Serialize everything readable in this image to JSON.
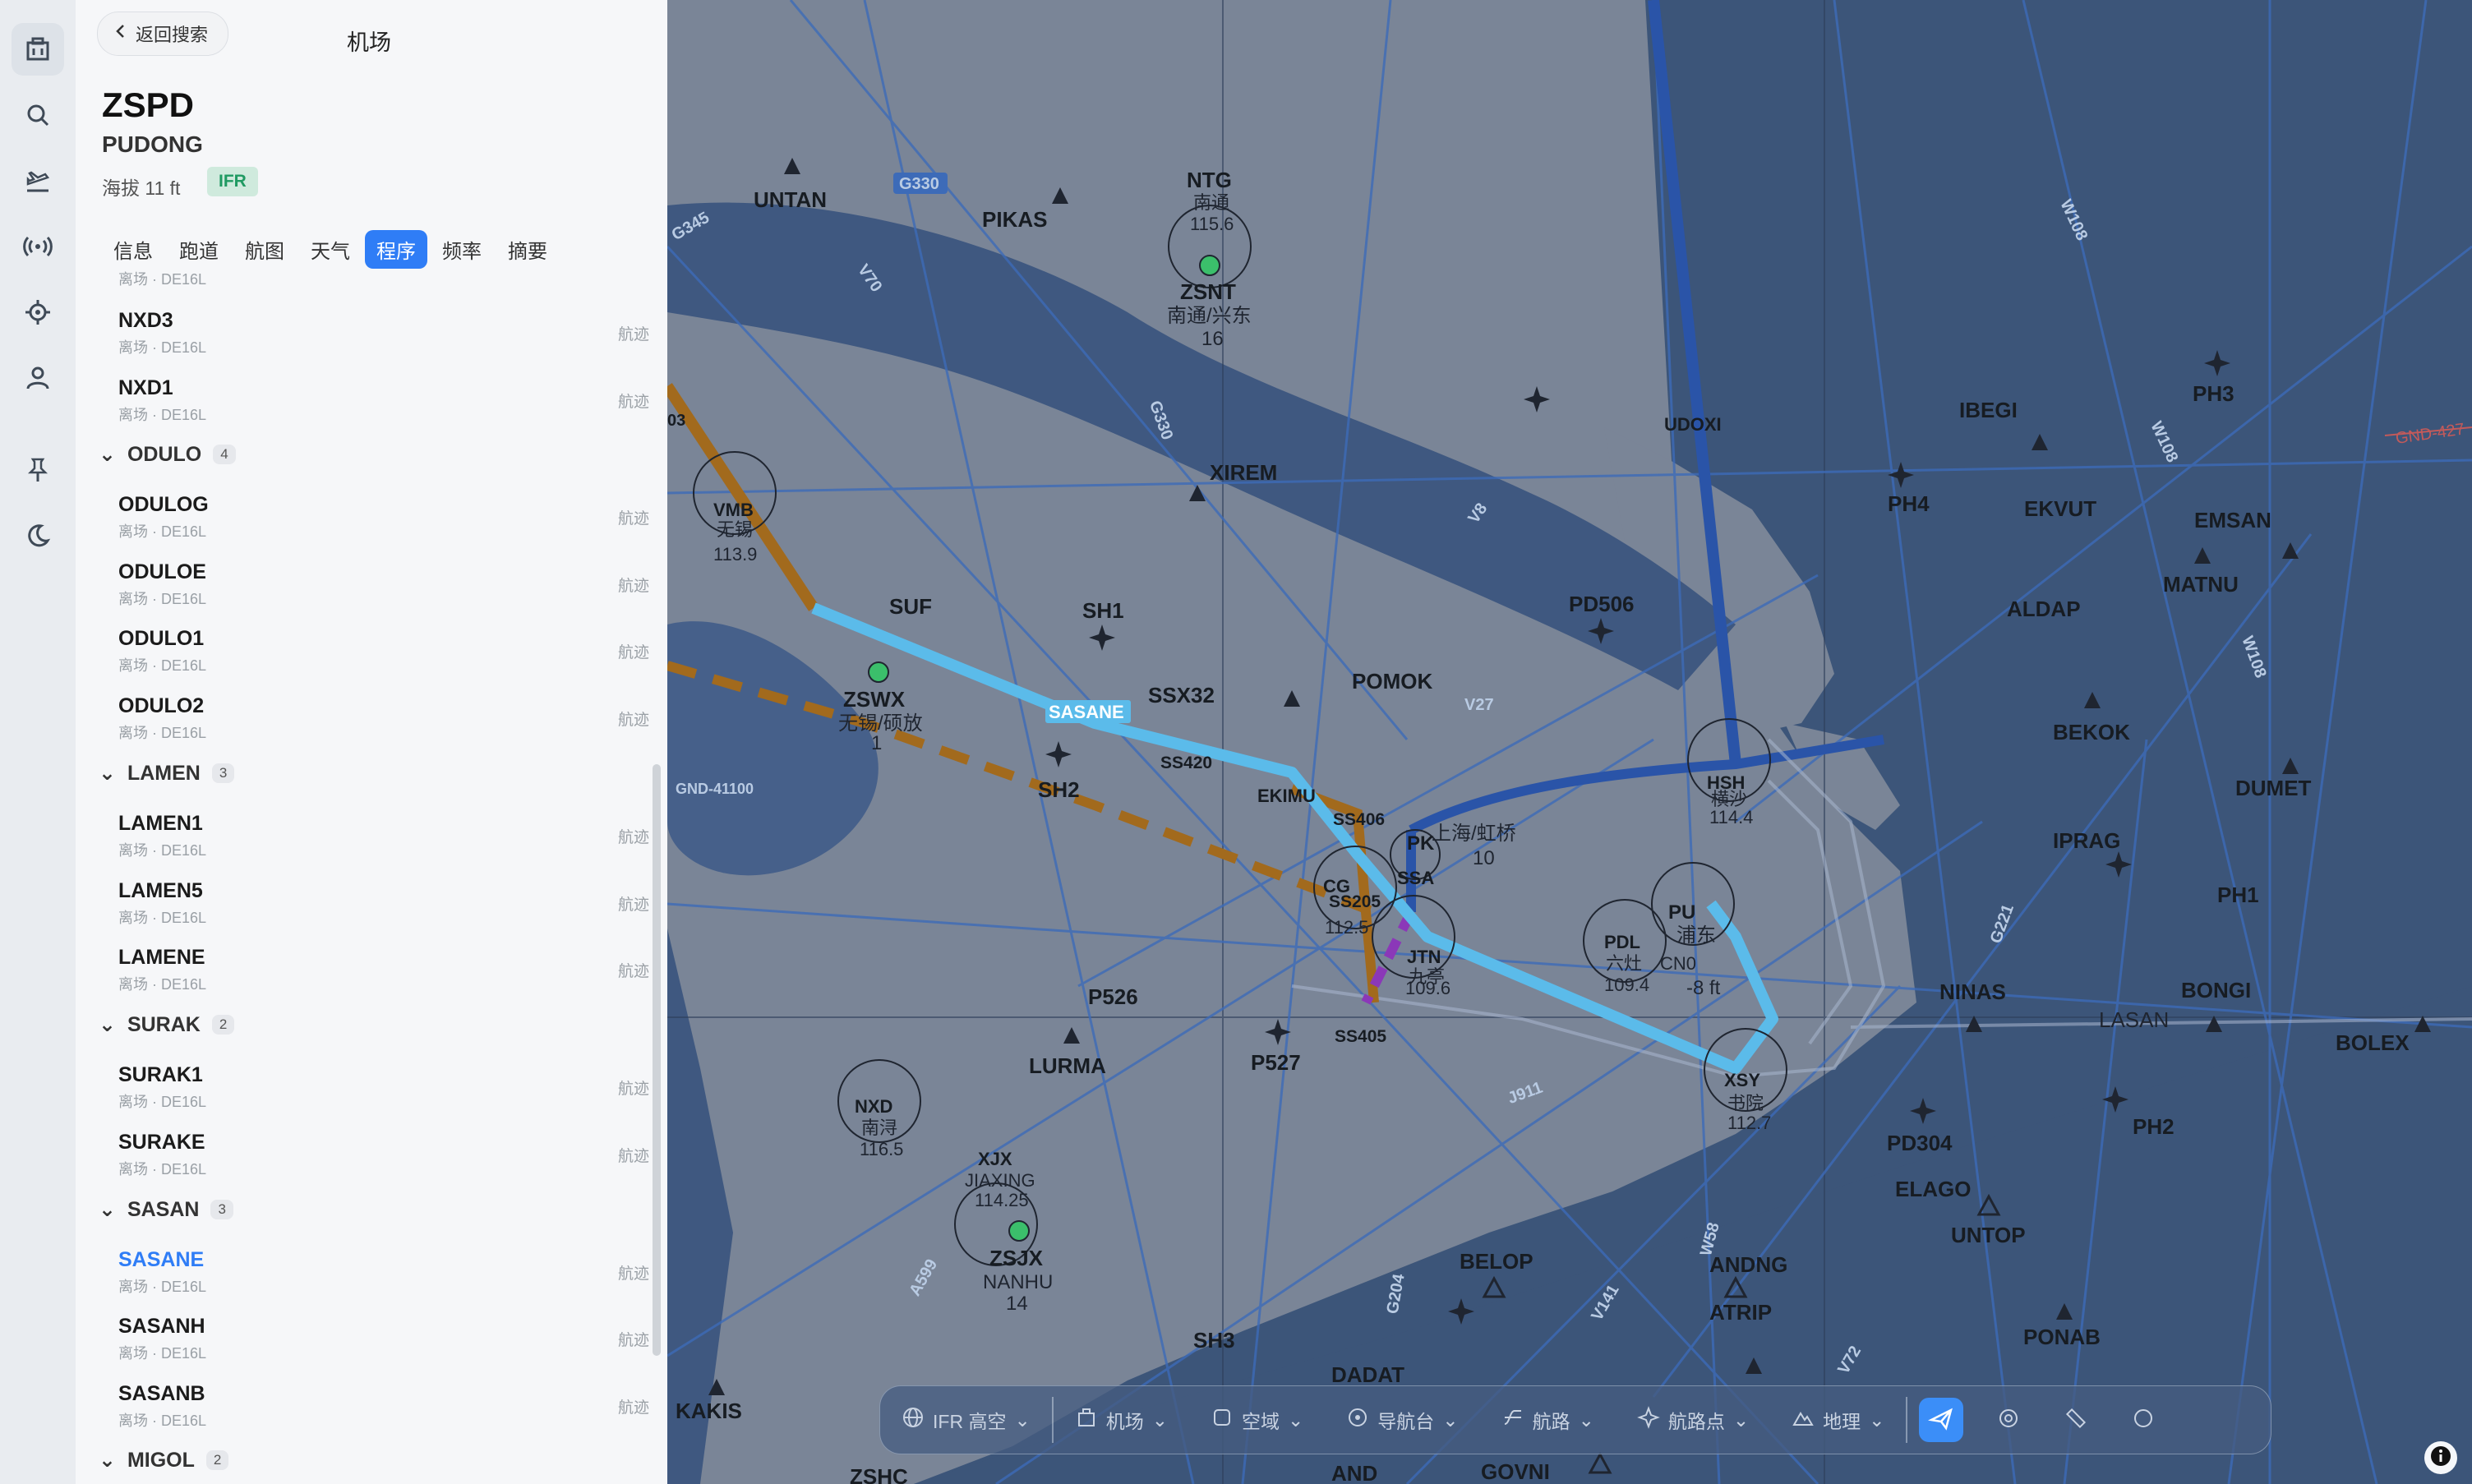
{
  "rail": {
    "items": [
      {
        "name": "airport-icon"
      },
      {
        "name": "search-icon"
      },
      {
        "name": "departure-icon"
      },
      {
        "name": "radio-icon"
      },
      {
        "name": "target-icon"
      },
      {
        "name": "user-icon"
      },
      {
        "name": "pin-icon"
      },
      {
        "name": "moon-icon"
      }
    ]
  },
  "panel": {
    "back_label": "返回搜索",
    "title": "机场",
    "icao": "ZSPD",
    "name": "PUDONG",
    "elevation": "海拔 11 ft",
    "flight_rule": "IFR",
    "tabs": [
      "信息",
      "跑道",
      "航图",
      "天气",
      "程序",
      "频率",
      "摘要"
    ],
    "active_tab": "程序",
    "top_sub": "离场 · DE16L",
    "track_label": "航迹",
    "rows": [
      {
        "name": "NXD3",
        "sub": "离场 · DE16L"
      },
      {
        "name": "NXD1",
        "sub": "离场 · DE16L"
      },
      {
        "name": "ODULOG",
        "sub": "离场 · DE16L"
      },
      {
        "name": "ODULOE",
        "sub": "离场 · DE16L"
      },
      {
        "name": "ODULO1",
        "sub": "离场 · DE16L"
      },
      {
        "name": "ODULO2",
        "sub": "离场 · DE16L"
      },
      {
        "name": "LAMEN1",
        "sub": "离场 · DE16L"
      },
      {
        "name": "LAMEN5",
        "sub": "离场 · DE16L"
      },
      {
        "name": "LAMENE",
        "sub": "离场 · DE16L"
      },
      {
        "name": "SURAK1",
        "sub": "离场 · DE16L"
      },
      {
        "name": "SURAKE",
        "sub": "离场 · DE16L"
      },
      {
        "name": "SASANE",
        "sub": "离场 · DE16L"
      },
      {
        "name": "SASANH",
        "sub": "离场 · DE16L"
      },
      {
        "name": "SASANB",
        "sub": "离场 · DE16L"
      }
    ],
    "groups": [
      {
        "name": "ODULO",
        "count": "4"
      },
      {
        "name": "LAMEN",
        "count": "3"
      },
      {
        "name": "SURAK",
        "count": "2"
      },
      {
        "name": "SASAN",
        "count": "3"
      },
      {
        "name": "MIGOL",
        "count": "2"
      }
    ]
  },
  "map": {
    "fixes": [
      "UNTAN",
      "PIKAS",
      "XIREM",
      "SUF",
      "SH1",
      "SSX32",
      "POMOK",
      "SH2",
      "EKIMU",
      "SS406",
      "SS420",
      "SS205",
      "SS405",
      "UDOXI",
      "PD506",
      "IBEGI",
      "PH3",
      "PH4",
      "EKVUT",
      "EMSAN",
      "ALDAP",
      "MATNU",
      "BEKOK",
      "DUMET",
      "IPRAG",
      "PH1",
      "NINAS",
      "LASAN",
      "BONGI",
      "BOLEX",
      "PD304",
      "ELAGO",
      "UNTOP",
      "PH2",
      "PONAB",
      "ANDNG",
      "ATRIP",
      "BELOP",
      "DADAT",
      "SH3",
      "P526",
      "P527",
      "LURMA",
      "KAKIS",
      "GOVNI",
      "AND",
      "ZSHC"
    ],
    "airways": [
      "G330",
      "V70",
      "G345",
      "G330",
      "V8",
      "V27",
      "W108",
      "W108",
      "W108",
      "G221",
      "J911",
      "W58",
      "G204",
      "V141",
      "V72",
      "A599"
    ],
    "navaids": [
      {
        "id": "NTG",
        "name": "南通",
        "freq": "115.6"
      },
      {
        "id": "VMB",
        "name": "无锡",
        "freq": "113.9"
      },
      {
        "id": "HSH",
        "name": "横沙",
        "freq": "114.4"
      },
      {
        "id": "PDL",
        "name": "六灶",
        "freq": "109.4"
      },
      {
        "id": "XSY",
        "name": "书院",
        "freq": "112.7"
      },
      {
        "id": "NXD",
        "name": "南浔",
        "freq": "116.5"
      },
      {
        "id": "XJX",
        "name": "JIAXING",
        "freq": "114.25"
      },
      {
        "id": "JTN",
        "name": "九亭",
        "freq": "109.6"
      },
      {
        "id": "CG",
        "name": "",
        "freq": "112.5"
      }
    ],
    "airports": [
      {
        "code": "ZSNT",
        "name": "南通/兴东",
        "elev": "16"
      },
      {
        "code": "ZSWX",
        "name": "无锡/硕放",
        "elev": "1"
      },
      {
        "code": "ZSJX",
        "name": "NANHU",
        "elev": "14"
      },
      {
        "code": "PK",
        "name": "上海/虹桥",
        "elev": "10"
      },
      {
        "code": "PU",
        "name": "浦东",
        "elev": "-8 ft"
      }
    ],
    "gnd_labels": [
      "GND-41100",
      "GND-427"
    ],
    "procedure_label": "SASANE",
    "extra_labels": [
      "03",
      "CN0",
      "SSA"
    ]
  },
  "toolbar": {
    "items": [
      "IFR 高空",
      "机场",
      "空域",
      "导航台",
      "航路",
      "航路点",
      "地理"
    ]
  },
  "colors": {
    "accent": "#2f7df6",
    "route": "#5bbbea",
    "gold": "#a26a1d",
    "sea": "#3c5579",
    "land": "#7a8597"
  }
}
